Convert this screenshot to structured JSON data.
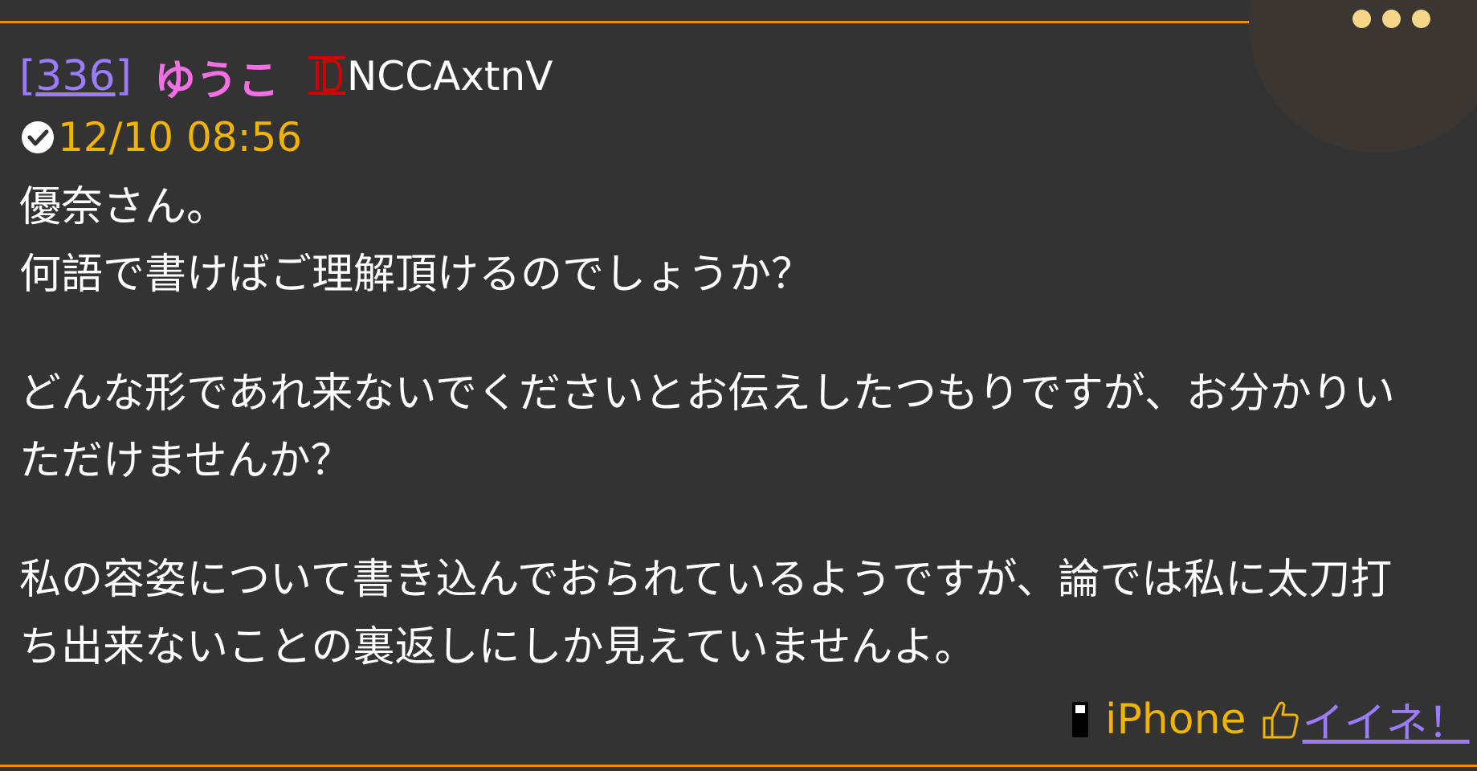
{
  "post": {
    "res_number": "336",
    "bracket_open": "[",
    "bracket_close": "]",
    "username": "ゆうこ",
    "id": "NCCAxtnV",
    "date": "12/10 08:56",
    "lines": [
      "優奈さん。",
      "何語で書けばご理解頂けるのでしょうか？",
      "",
      "どんな形であれ来ないでくださいとお伝えしたつもりですが、お分かりい",
      "ただけませんか？",
      "",
      "私の容姿について書き込んでおられているようですが、論では私に太刀打",
      "ち出来ないことの裏返しにしか見えていませんよ。"
    ],
    "device": "iPhone",
    "like_label": "イイネ！"
  },
  "colors": {
    "accent_orange": "#e88f10",
    "link_purple": "#9b7cff",
    "username_pink": "#f36fe4",
    "date_yellow": "#f0b400",
    "background": "#333333"
  },
  "icons": {
    "id": "id-badge-icon",
    "clock": "clock-check-icon",
    "phone": "mobile-phone-icon",
    "like": "thumbs-up-icon",
    "menu": "more-dots-icon"
  }
}
